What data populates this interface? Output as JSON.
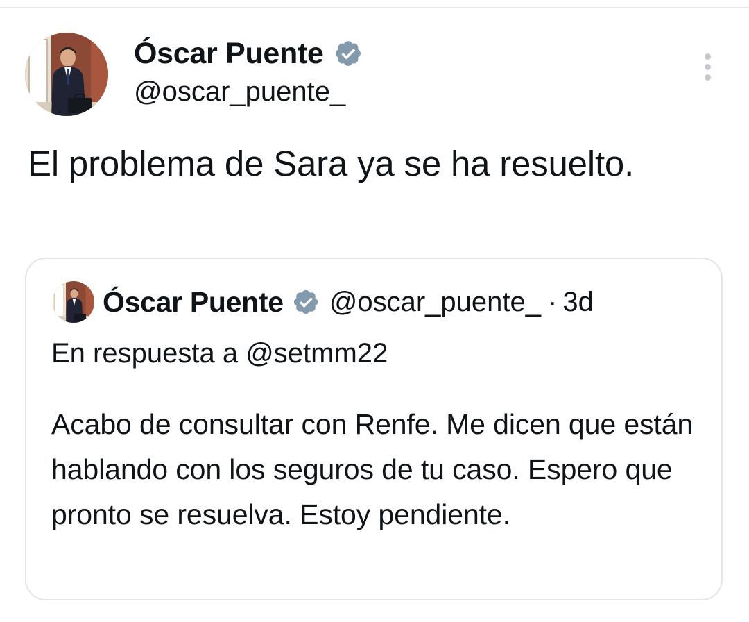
{
  "tweet": {
    "author_name": "Óscar Puente",
    "handle": "@oscar_puente_",
    "text": "El problema de Sara ya se ha resuelto.",
    "verified_icon": "verified-badge-icon",
    "more_icon": "more-vertical-icon"
  },
  "quoted_tweet": {
    "author_name": "Óscar Puente",
    "handle": "@oscar_puente_",
    "separator": "·",
    "time": "3d",
    "reply_to": "En respuesta a @setmm22",
    "text": "Acabo de consultar con Renfe. Me dicen que están hablando con los seguros de tu caso. Espero que pronto se resuelva. Estoy pendiente."
  },
  "colors": {
    "text": "#0f1419",
    "verified_badge": "#829aab",
    "border": "#e2e6e9",
    "more_dots": "#c3c8cd"
  }
}
